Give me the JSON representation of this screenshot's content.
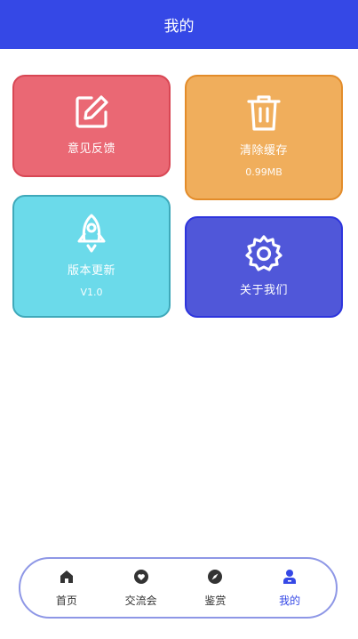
{
  "header": {
    "title": "我的"
  },
  "cards": {
    "feedback": {
      "label": "意见反馈",
      "icon": "edit-icon"
    },
    "cache": {
      "label": "清除缓存",
      "value": "0.99MB",
      "icon": "trash-icon"
    },
    "version": {
      "label": "版本更新",
      "value": "V1.0",
      "icon": "rocket-icon"
    },
    "about": {
      "label": "关于我们",
      "icon": "gear-icon"
    }
  },
  "tabs": [
    {
      "label": "首页",
      "icon": "home-icon"
    },
    {
      "label": "交流会",
      "icon": "chat-heart-icon"
    },
    {
      "label": "鉴赏",
      "icon": "compass-icon"
    },
    {
      "label": "我的",
      "icon": "user-icon",
      "active": true
    }
  ],
  "colors": {
    "primary": "#3548e6",
    "feedback": "#ea6874",
    "cache": "#f0ae5c",
    "version": "#6bdaea",
    "about": "#5057d9"
  }
}
